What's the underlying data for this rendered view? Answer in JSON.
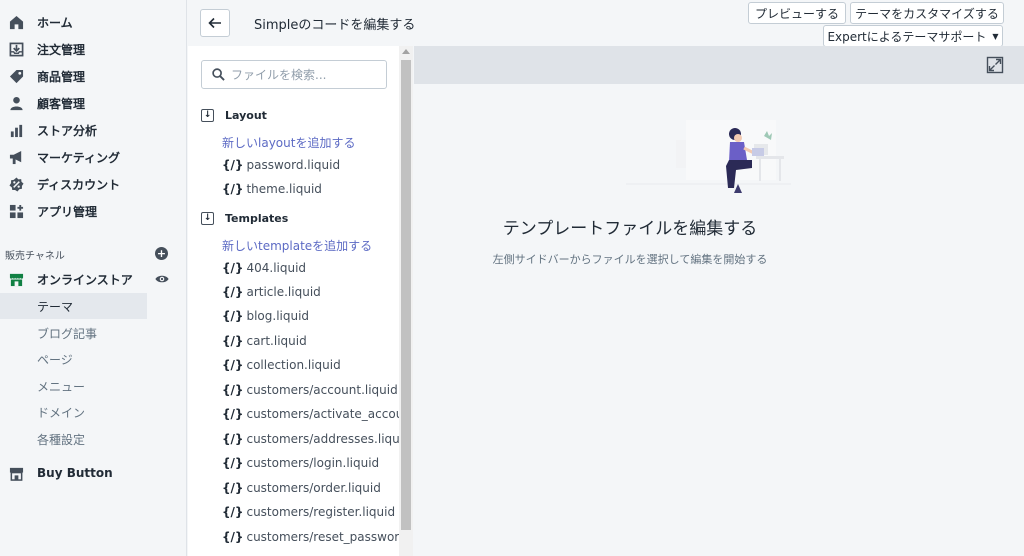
{
  "nav": {
    "items": [
      {
        "label": "ホーム",
        "icon": "home-icon"
      },
      {
        "label": "注文管理",
        "icon": "orders-icon"
      },
      {
        "label": "商品管理",
        "icon": "tag-icon"
      },
      {
        "label": "顧客管理",
        "icon": "customer-icon"
      },
      {
        "label": "ストア分析",
        "icon": "analytics-icon"
      },
      {
        "label": "マーケティング",
        "icon": "megaphone-icon"
      },
      {
        "label": "ディスカウント",
        "icon": "discount-icon"
      },
      {
        "label": "アプリ管理",
        "icon": "apps-icon"
      }
    ],
    "channels_title": "販売チャネル",
    "online_store": "オンラインストア",
    "sub_items": [
      "テーマ",
      "ブログ記事",
      "ページ",
      "メニュー",
      "ドメイン",
      "各種設定"
    ],
    "buy_button": "Buy Button"
  },
  "header": {
    "title": "Simpleのコードを編集する",
    "preview": "プレビューする",
    "customize": "テーマをカスタマイズする",
    "expert": "Expertによるテーマサポート"
  },
  "files": {
    "search_placeholder": "ファイルを検索...",
    "layout_title": "Layout",
    "layout_add": "新しいlayoutを追加する",
    "layout_files": [
      "password.liquid",
      "theme.liquid"
    ],
    "templates_title": "Templates",
    "templates_add": "新しいtemplateを追加する",
    "template_files": [
      "404.liquid",
      "article.liquid",
      "blog.liquid",
      "cart.liquid",
      "collection.liquid",
      "customers/account.liquid",
      "customers/activate_account.liquid",
      "customers/addresses.liquid",
      "customers/login.liquid",
      "customers/order.liquid",
      "customers/register.liquid",
      "customers/reset_password.liquid"
    ],
    "brace": "{/}"
  },
  "main": {
    "empty_title": "テンプレートファイルを編集する",
    "empty_desc": "左側サイドバーからファイルを選択して編集を開始する"
  },
  "colors": {
    "accent": "#5c6ac4",
    "nav_bg": "#f4f6f8",
    "icon": "#454f5b"
  }
}
